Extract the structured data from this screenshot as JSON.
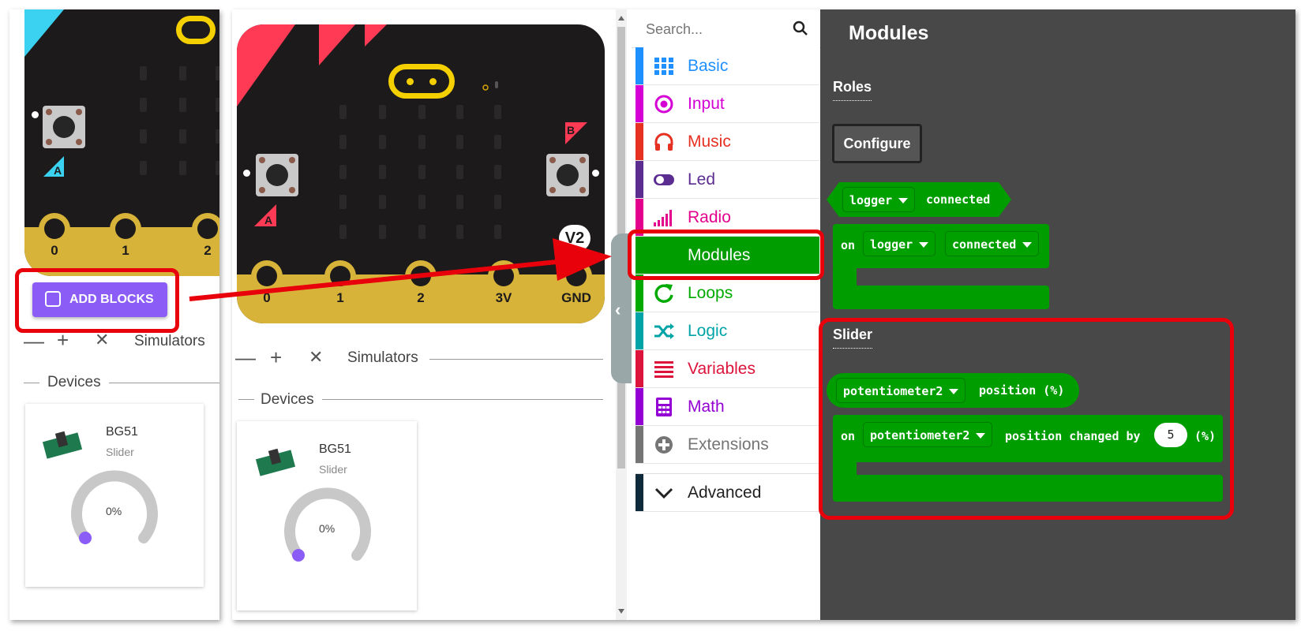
{
  "left_panel": {
    "pin_labels": [
      "0",
      "1",
      "2"
    ],
    "button_a": "A",
    "add_blocks_label": "ADD BLOCKS",
    "toolbar": {
      "minus": "—",
      "plus": "+",
      "close": "✕"
    },
    "simulators_label": "Simulators",
    "devices_label": "Devices",
    "device": {
      "name": "BG51",
      "type": "Slider",
      "value": "0%"
    }
  },
  "mid_panel": {
    "pin_labels": [
      "0",
      "1",
      "2",
      "3V",
      "GND"
    ],
    "button_a": "A",
    "button_b": "B",
    "version_badge": "V2",
    "toolbar": {
      "minus": "—",
      "plus": "+",
      "close": "✕"
    },
    "simulators_label": "Simulators",
    "devices_label": "Devices",
    "device": {
      "name": "BG51",
      "type": "Slider",
      "value": "0%"
    }
  },
  "toolbox": {
    "search_placeholder": "Search...",
    "categories": [
      {
        "label": "Basic",
        "color": "#1e90ff",
        "icon": "grid-icon"
      },
      {
        "label": "Input",
        "color": "#d400d4",
        "icon": "input-circle-icon"
      },
      {
        "label": "Music",
        "color": "#e63022",
        "icon": "headphones-icon"
      },
      {
        "label": "Led",
        "color": "#5c2d91",
        "icon": "toggle-icon"
      },
      {
        "label": "Radio",
        "color": "#e3008c",
        "icon": "signal-bars-icon"
      },
      {
        "label": "Modules",
        "color": "#009d00",
        "icon": "none"
      },
      {
        "label": "Loops",
        "color": "#00aa00",
        "icon": "loop-arrow-icon"
      },
      {
        "label": "Logic",
        "color": "#00a4a6",
        "icon": "shuffle-icon"
      },
      {
        "label": "Variables",
        "color": "#dc143c",
        "icon": "lines-icon"
      },
      {
        "label": "Math",
        "color": "#9400d3",
        "icon": "calculator-icon"
      },
      {
        "label": "Extensions",
        "color": "#757575",
        "icon": "plus-circle-icon"
      }
    ],
    "advanced_label": "Advanced"
  },
  "flyout": {
    "title": "Modules",
    "roles_heading": "Roles",
    "configure_label": "Configure",
    "logger_reporter": {
      "dropdown": "logger",
      "text": "connected"
    },
    "logger_event": {
      "prefix": "on",
      "dropdown1": "logger",
      "dropdown2": "connected"
    },
    "slider_heading": "Slider",
    "position_reporter": {
      "dropdown": "potentiometer2",
      "text": "position (%)"
    },
    "position_event": {
      "prefix": "on",
      "dropdown": "potentiometer2",
      "text": "position changed by",
      "value": "5",
      "suffix": "(%)"
    }
  },
  "colors": {
    "highlight": "#e8000b",
    "modules_green": "#009d00",
    "add_blocks_purple": "#8b5cf6",
    "flyout_bg": "#484848"
  }
}
